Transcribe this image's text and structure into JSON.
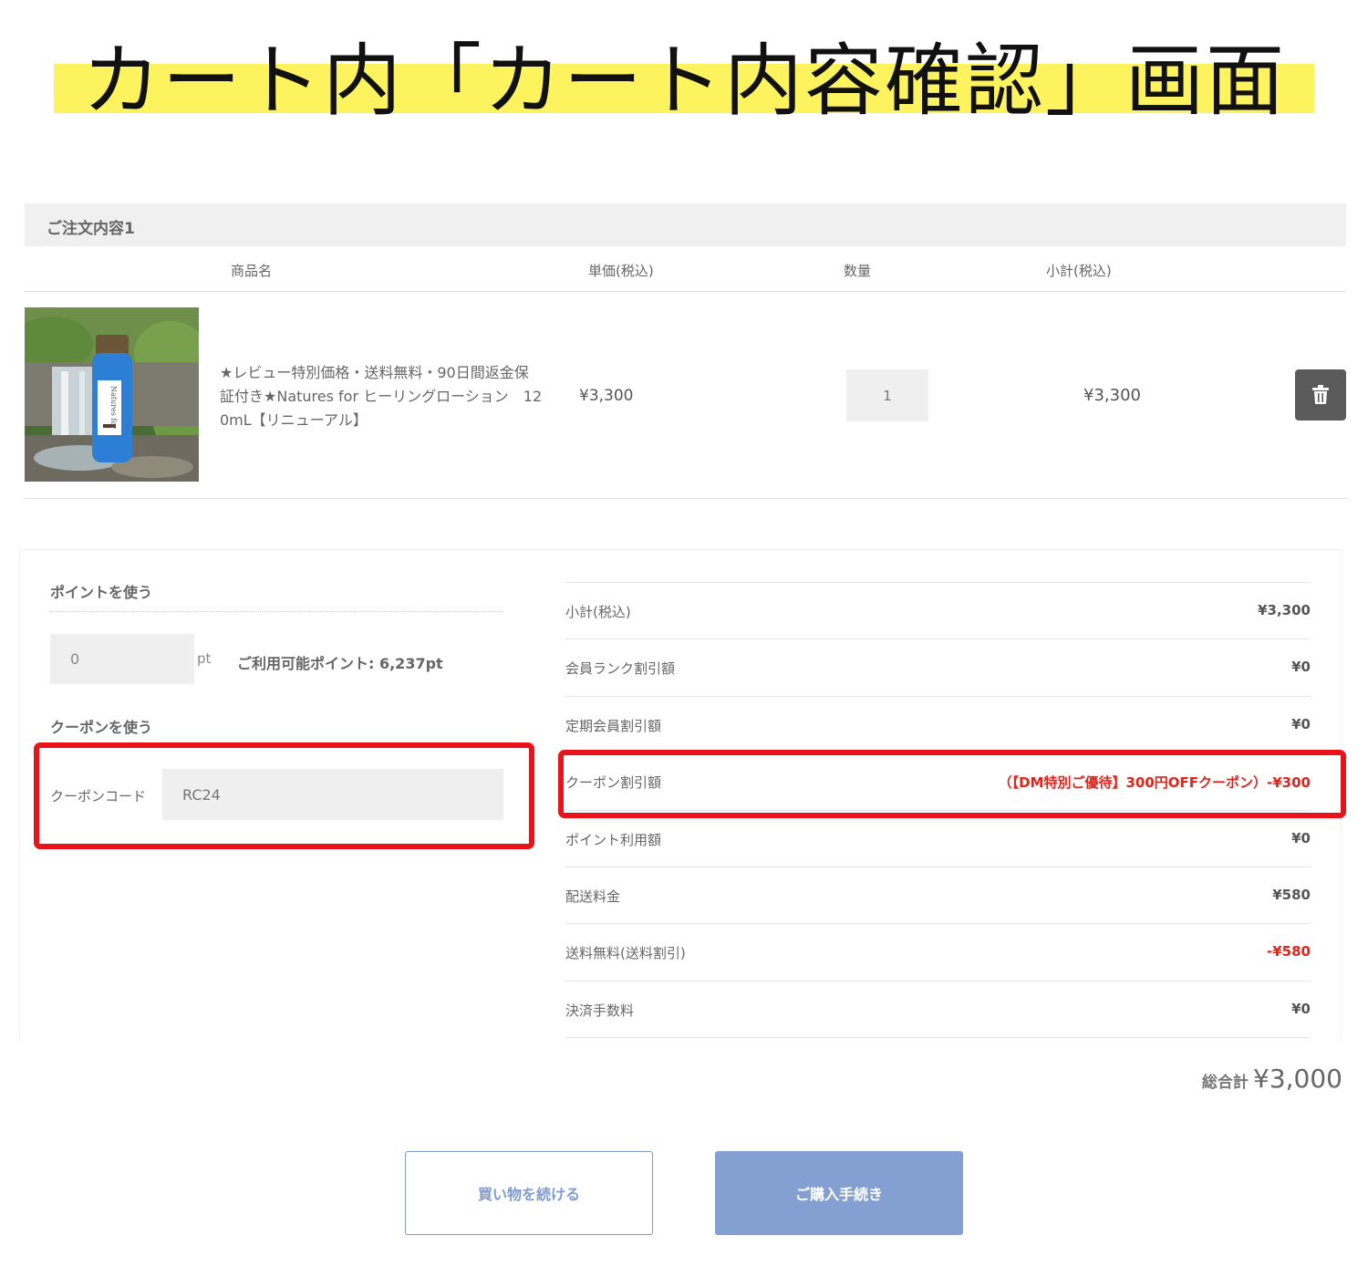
{
  "banner": {
    "title": "カート内「カート内容確認」画面"
  },
  "order": {
    "header": "ご注文内容1",
    "columns": {
      "name": "商品名",
      "unit_price": "単価(税込)",
      "quantity": "数量",
      "subtotal": "小計(税込)"
    },
    "item": {
      "name_line1": "★レビュー特別価格・送料無料・90日間返金保",
      "name_line2": "証付き★Natures for ヒーリングローション　12",
      "name_line3": "0mL【リニューアル】",
      "unit_price": "¥3,300",
      "quantity": "1",
      "subtotal": "¥3,300",
      "bottle_label": "Natures for"
    }
  },
  "points": {
    "title": "ポイントを使う",
    "value": "0",
    "unit": "pt",
    "available": "ご利用可能ポイント: 6,237pt"
  },
  "coupon": {
    "title": "クーポンを使う",
    "label": "クーポンコード",
    "value": "RC24"
  },
  "summary": [
    {
      "label": "小計(税込)",
      "value": "¥3,300",
      "highlight": false
    },
    {
      "label": "会員ランク割引額",
      "value": "¥0",
      "highlight": false
    },
    {
      "label": "定期会員割引額",
      "value": "¥0",
      "highlight": false
    },
    {
      "label": "クーポン割引額",
      "value": "（【DM特別ご優待】300円OFFクーポン）-¥300",
      "highlight": true
    },
    {
      "label": "ポイント利用額",
      "value": "¥0",
      "highlight": false
    },
    {
      "label": "配送料金",
      "value": "¥580",
      "highlight": false
    },
    {
      "label": "送料無料(送料割引)",
      "value": "-¥580",
      "highlight": true
    },
    {
      "label": "決済手数料",
      "value": "¥0",
      "highlight": false
    }
  ],
  "total": {
    "label": "総合計",
    "value": "¥3,000"
  },
  "buttons": {
    "continue": "買い物を続ける",
    "checkout": "ご購入手続き"
  },
  "colors": {
    "highlight_red": "#e2231a",
    "annotation_red": "#e8141a",
    "banner_yellow": "#fdf35f",
    "accent_blue": "#849fd1"
  }
}
